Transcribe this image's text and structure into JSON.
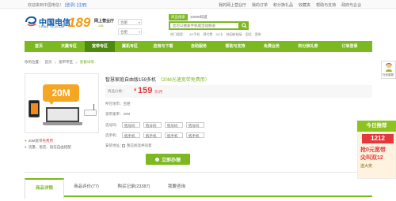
{
  "topbar": {
    "welcome": "欢迎来到中国电信！",
    "login": "[登录]",
    "register": "[注册]",
    "links": [
      "我的网上营业厅",
      "我的订单",
      "积分换礼品",
      "收藏夹",
      "帮助与支持",
      "政府与企业"
    ]
  },
  "logo": {
    "brand": "中国电信",
    "brand_en": "CHINA TELECOM",
    "number": "189",
    "hall": "网上营业厅",
    "cn": ".cn"
  },
  "region": {
    "province": "合肥",
    "city": "合肥"
  },
  "search": {
    "tabs": [
      "商品搜索",
      "10000知道"
    ],
    "placeholder": "您可以搜索手机或活动频道",
    "hot": [
      "热门搜索：",
      "4G手机",
      "预付费",
      "3G卡",
      "校园新链接",
      "固话",
      "宽带"
    ]
  },
  "nav": {
    "items": [
      "首页",
      "天翼专区",
      "宽带专区",
      "翼机专区",
      "应用与下载",
      "自助服务",
      "帮助与支持",
      "免费业务",
      "积分换礼券",
      "订单登录"
    ]
  },
  "breadcrumb": {
    "prefix": "你的位置：",
    "home": "首页",
    "sep": ">",
    "level1": "宽带专区",
    "current": "套餐详情"
  },
  "product": {
    "banner_value": "20M",
    "title": "智慧家庭自由版159多机",
    "title_promo": "（20M光速宽带免费用）",
    "price_label": "商品价格：",
    "price_symbol": "¥",
    "price": "159",
    "price_unit": "元/月",
    "location_label": "所在地市：",
    "location": "合肥",
    "speed_label": "宽带速率：",
    "speed": "20M",
    "numbers_label": "选号码：",
    "phone_label": "选手机：",
    "option_number": "选号码",
    "option_phone": "选手机",
    "install_label": "安装地址：",
    "agree": "我已阅读并同意",
    "buy_button": "立即办理",
    "features": [
      "20M宽带",
      "免费用",
      "流量、语音、短信自由搭配"
    ]
  },
  "tabs": [
    "商品详情",
    "商品评价(77)",
    "购买记录(23387)",
    "我要咨询"
  ],
  "side": {
    "online": "在线客服",
    "promo_title": "今日推荐",
    "promo_t1": "1212",
    "promo_t2": "抢0元宽带",
    "promo_t3": "尖叫双12",
    "promo_t4": "送大奖"
  }
}
